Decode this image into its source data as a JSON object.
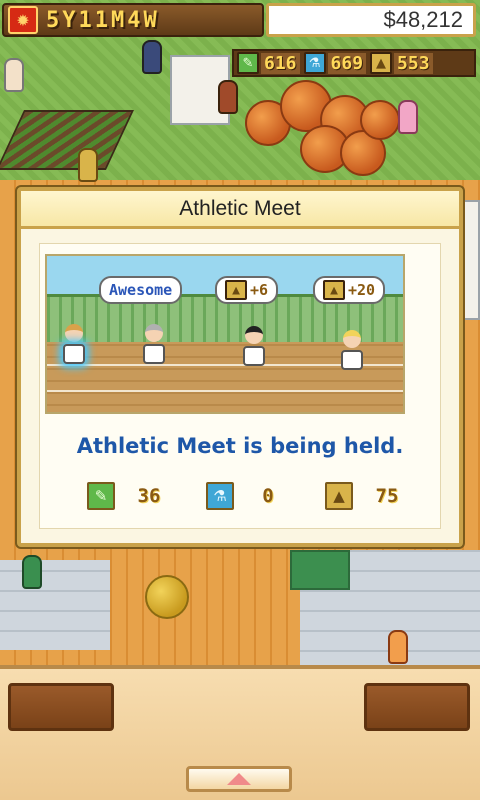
{
  "hud": {
    "date": "5Y11M4W",
    "money": "$48,212",
    "resources": [
      {
        "icon": "pencil-icon",
        "value": "616",
        "color": "#5fb84a"
      },
      {
        "icon": "flask-icon",
        "value": "669",
        "color": "#3fa7d6"
      },
      {
        "icon": "brain-icon",
        "value": "553",
        "color": "#d9b44a"
      }
    ]
  },
  "dialog": {
    "title": "Athletic Meet",
    "scene": {
      "bubble_text": "Awesome",
      "bonus_1": "+6",
      "bonus_2": "+20"
    },
    "message": "Athletic Meet is being held.",
    "rewards": [
      {
        "icon": "pencil-icon",
        "value": "36"
      },
      {
        "icon": "flask-icon",
        "value": "0"
      },
      {
        "icon": "brain-icon",
        "value": "75"
      }
    ]
  },
  "colors": {
    "dialog_border": "#c9a24a",
    "message_text": "#1e57a8",
    "hud_digits": "#ffd95a"
  }
}
